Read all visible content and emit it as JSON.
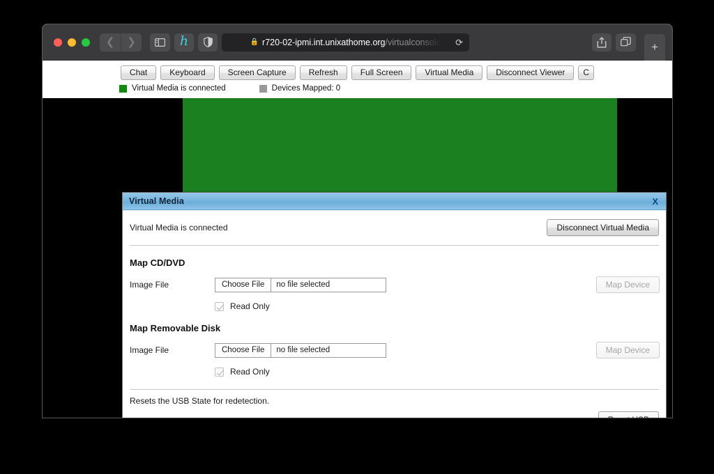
{
  "browser": {
    "traffic_lights": [
      "close",
      "minimize",
      "zoom"
    ],
    "nav_back_icon": "‹",
    "nav_forward_icon": "›",
    "sidebar_icon": "sidebar-icon",
    "extension_icon_label": "h",
    "shield_icon": "shield-icon",
    "address": {
      "lock_icon": "🔒",
      "host": "r720-02-ipmi.int.unixathome.org",
      "path": "/virtualconsole",
      "reload_icon": "⟳"
    },
    "share_icon": "share-icon",
    "tabs_icon": "tab-overview-icon",
    "new_tab_label": "+"
  },
  "ipmi": {
    "toolbar_buttons": [
      "Chat",
      "Keyboard",
      "Screen Capture",
      "Refresh",
      "Full Screen",
      "Virtual Media",
      "Disconnect Viewer",
      "C"
    ],
    "status": {
      "virtual_media": {
        "label": "Virtual Media is connected",
        "color": "#118811"
      },
      "devices_mapped": {
        "label": "Devices Mapped: 0",
        "color": "#999999"
      }
    },
    "console_background": "#1b8020"
  },
  "dialog": {
    "title": "Virtual Media",
    "close_label": "X",
    "connection_status": "Virtual Media is connected",
    "disconnect_button": "Disconnect Virtual Media",
    "sections": [
      {
        "heading": "Map CD/DVD",
        "field_label": "Image File",
        "choose_file_label": "Choose File",
        "file_name": "no file selected",
        "map_button": "Map Device",
        "checkbox_label": "Read Only",
        "checkbox_checked": true
      },
      {
        "heading": "Map Removable Disk",
        "field_label": "Image File",
        "choose_file_label": "Choose File",
        "file_name": "no file selected",
        "map_button": "Map Device",
        "checkbox_label": "Read Only",
        "checkbox_checked": true
      }
    ],
    "footer_note": "Resets the USB State for redetection.",
    "reset_button": "Reset USB",
    "titlebar_color": "#79b5de"
  }
}
